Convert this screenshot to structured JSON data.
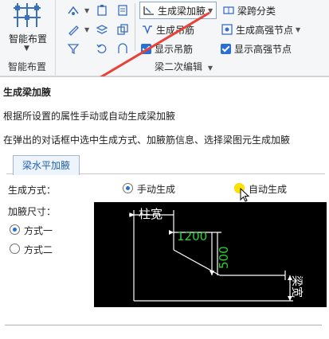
{
  "ribbon": {
    "smart_layout_label": "智能布置",
    "smart_layout_group": "智能布置",
    "beam_secondary_group": "梁二次编辑",
    "gen_haunch": "生成梁加腋",
    "beam_span_class": "梁跨分类",
    "gen_hanger": "生成吊筋",
    "gen_hs_node": "生成高强节点",
    "show_hanger": "显示吊筋",
    "show_hs_node": "显示高强节点"
  },
  "tooltip": {
    "title": "生成梁加腋",
    "line1": "根据所设置的属性手动或自动生成梁加腋",
    "line2": "在弹出的对话框中选中生成方式、加腋筋信息、选择梁图元生成加腋"
  },
  "dialog": {
    "tab": "梁水平加腋",
    "mode_label": "生成方式：",
    "manual": "手动生成",
    "auto": "自动生成",
    "size_label": "加腋尺寸：",
    "option1": "方式一",
    "option2": "方式二"
  },
  "preview": {
    "col_width": "柱宽",
    "dim1": "1200",
    "dim2": "500",
    "beam_width": "梁宽"
  },
  "colors": {
    "accent": "#2a6fd6",
    "arrow": "#e8413a",
    "dim_green": "#29d33a"
  }
}
